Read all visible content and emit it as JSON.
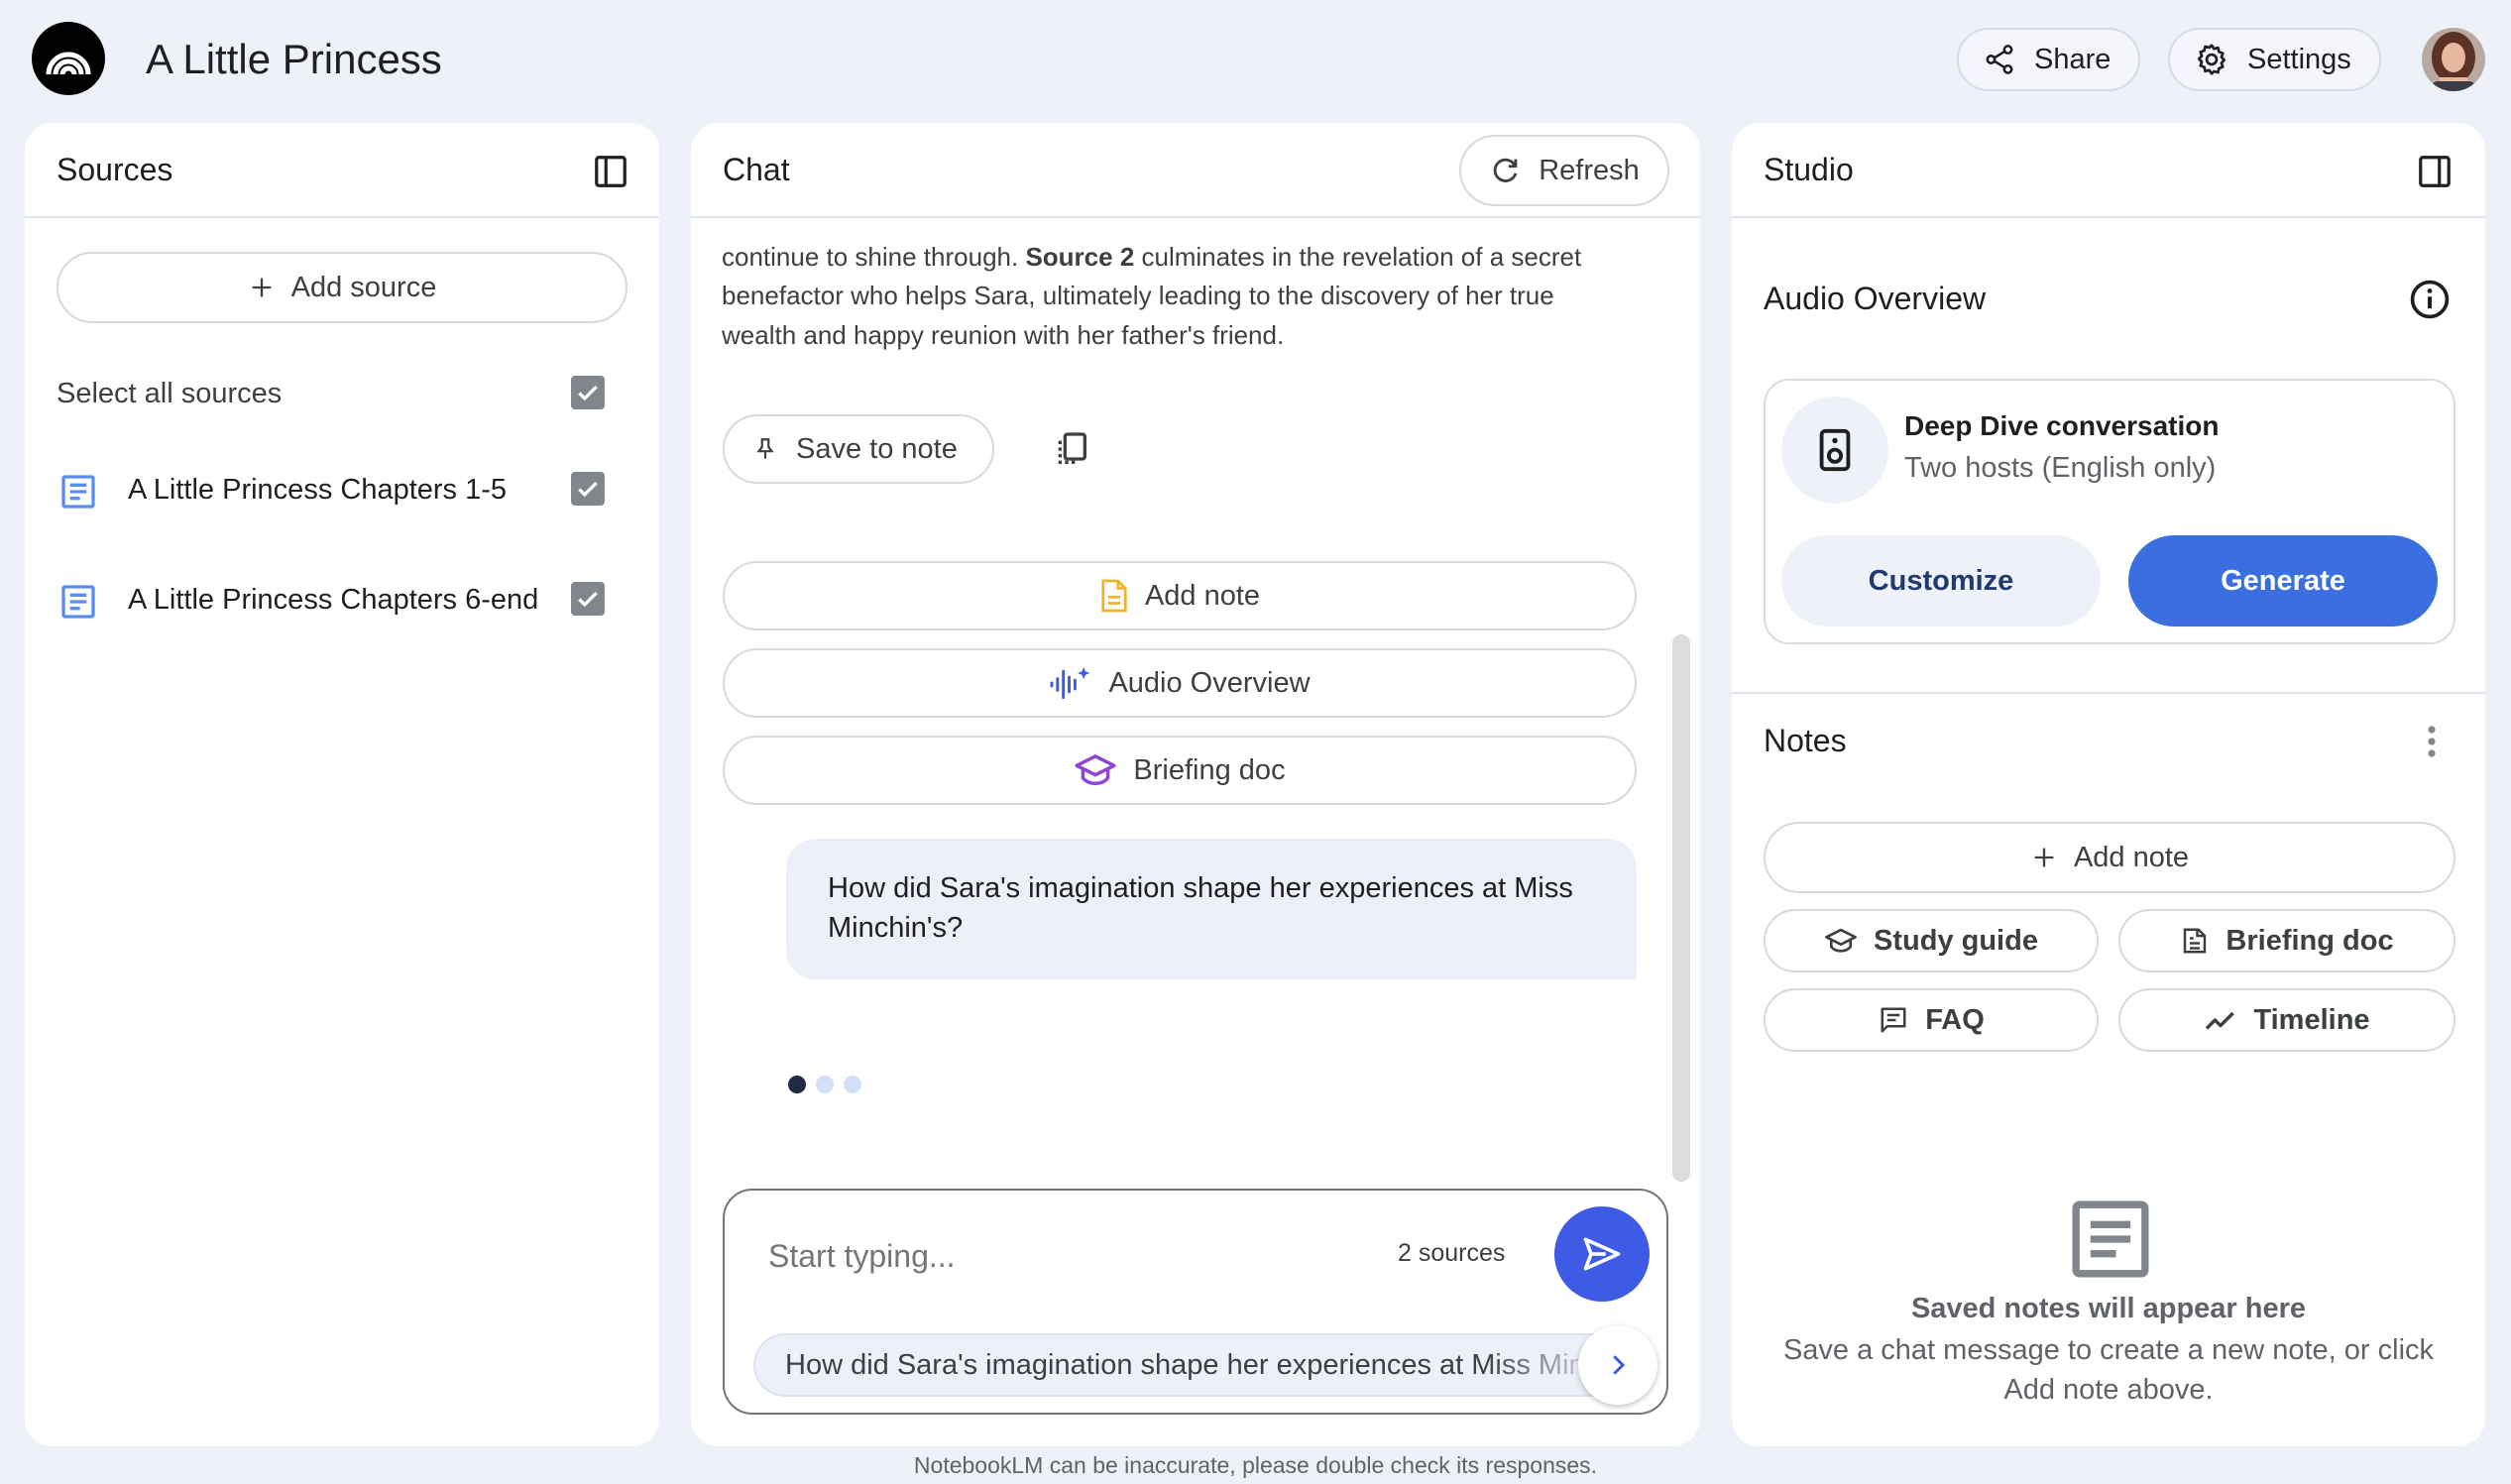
{
  "header": {
    "app_title": "A Little Princess",
    "share_label": "Share",
    "settings_label": "Settings"
  },
  "sources": {
    "title": "Sources",
    "add_source_label": "Add source",
    "select_all_label": "Select all sources",
    "items": [
      {
        "label": "A Little Princess Chapters 1-5",
        "checked": true
      },
      {
        "label": "A Little Princess Chapters 6-end",
        "checked": true
      }
    ]
  },
  "chat": {
    "title": "Chat",
    "refresh_label": "Refresh",
    "response_partial_line_pre": "continue to shine through. ",
    "response_partial_line_bold": "Source 2",
    "response_partial_line_post": " culminates in the revelation of a secret",
    "response_line_2": "benefactor who helps Sara, ultimately leading to the discovery of her true",
    "response_line_3": "wealth and happy reunion with her father's friend.",
    "save_to_note_label": "Save to note",
    "actions": {
      "add_note": "Add note",
      "audio_overview": "Audio Overview",
      "briefing_doc": "Briefing doc"
    },
    "user_message": "How did Sara's imagination shape her experiences at Miss Minchin's?",
    "input_placeholder": "Start typing...",
    "source_count": "2 sources",
    "suggestion": "How did Sara's imagination shape her experiences at Miss Minchin's?"
  },
  "studio": {
    "title": "Studio",
    "audio_overview_title": "Audio Overview",
    "audio_card": {
      "title": "Deep Dive conversation",
      "subtitle": "Two hosts (English only)",
      "customize_label": "Customize",
      "generate_label": "Generate"
    },
    "notes_title": "Notes",
    "add_note_label": "Add note",
    "note_buttons": {
      "study_guide": "Study guide",
      "briefing_doc": "Briefing doc",
      "faq": "FAQ",
      "timeline": "Timeline"
    },
    "empty_title": "Saved notes will appear here",
    "empty_desc_1": "Save a chat message to create a new note, or click",
    "empty_desc_2": "Add note above."
  },
  "footer_text": "NotebookLM can be inaccurate, please double check its responses.",
  "colors": {
    "background": "#eef1f8",
    "accent_blue": "#3e5be6",
    "generate_blue": "#3b6fe0",
    "doc_icon_blue": "#5b8def",
    "note_icon_yellow": "#f2b32c",
    "briefing_icon_purple": "#8e44d8"
  }
}
